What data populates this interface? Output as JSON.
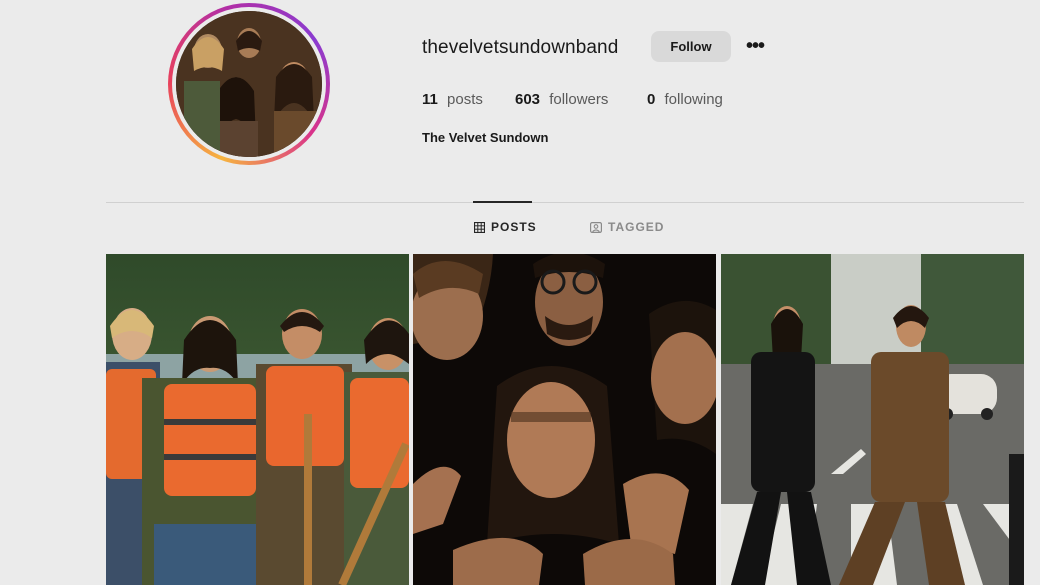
{
  "profile": {
    "username": "thevelvetsundownband",
    "follow_label": "Follow",
    "more_label": "•••",
    "full_name": "The Velvet Sundown"
  },
  "stats": {
    "posts_count": "11",
    "posts_label": "posts",
    "followers_count": "603",
    "followers_label": "followers",
    "following_count": "0",
    "following_label": "following"
  },
  "tabs": [
    {
      "label": "POSTS",
      "icon": "grid-icon",
      "active": true
    },
    {
      "label": "TAGGED",
      "icon": "tag-icon",
      "active": false
    }
  ],
  "colors": {
    "background": "#ebebeb",
    "follow_button": "#d9d9d9",
    "story_ring": [
      "#f6b440",
      "#e8405c",
      "#b22fa6",
      "#8a3bd0"
    ]
  }
}
